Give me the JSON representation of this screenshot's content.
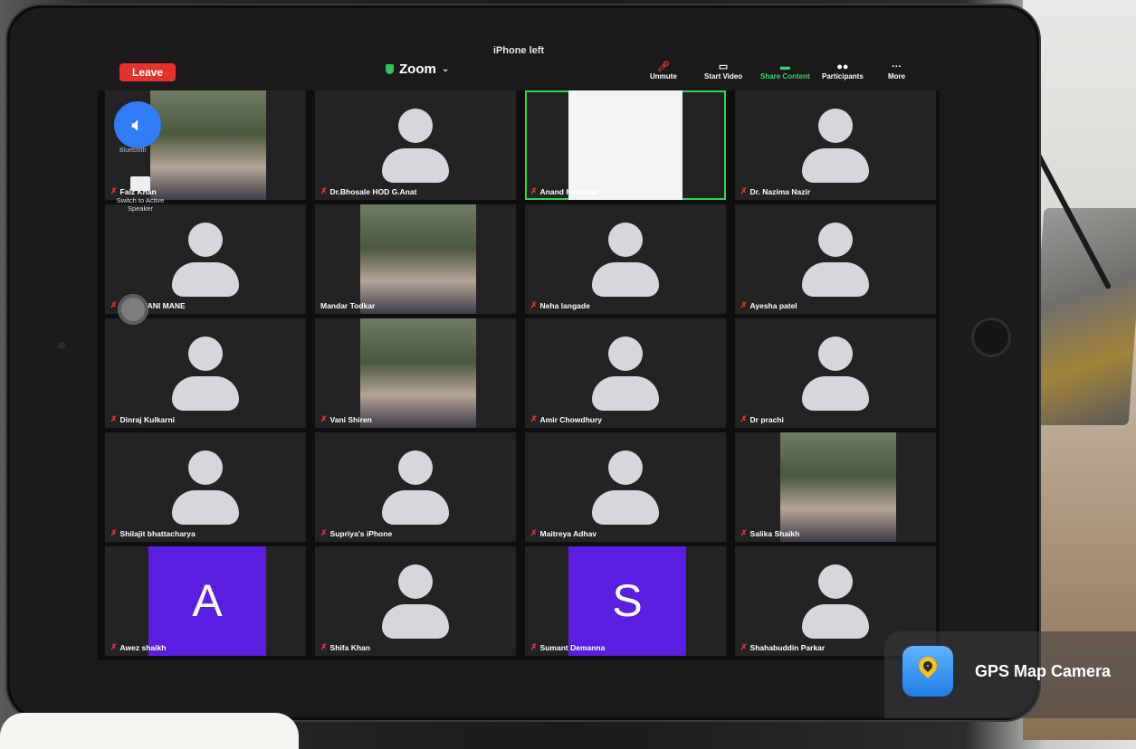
{
  "device_name": "iPhone left",
  "toolbar": {
    "leave": "Leave",
    "app_title": "Zoom",
    "buttons": [
      {
        "label": "Unmute"
      },
      {
        "label": "Start Video"
      },
      {
        "label": "Share Content"
      },
      {
        "label": "Participants"
      },
      {
        "label": "More"
      }
    ]
  },
  "controls": {
    "bluetooth_label": "Bluetooth",
    "switch_speaker": "Switch to Active Speaker"
  },
  "participants": [
    {
      "name": "Faiz Khan",
      "muted": true,
      "kind": "photo"
    },
    {
      "name": "Dr.Bhosale HOD G.Anat",
      "muted": true,
      "kind": "avatar"
    },
    {
      "name": "Anand Kalaskar",
      "muted": true,
      "kind": "video-white",
      "active": true
    },
    {
      "name": "Dr. Nazima Nazir",
      "muted": true,
      "kind": "avatar"
    },
    {
      "name": "SANJIVANI MANE",
      "muted": true,
      "kind": "avatar"
    },
    {
      "name": "Mandar Todkar",
      "muted": false,
      "kind": "photo"
    },
    {
      "name": "Neha langade",
      "muted": true,
      "kind": "avatar"
    },
    {
      "name": "Ayesha patel",
      "muted": true,
      "kind": "avatar"
    },
    {
      "name": "Dinraj Kulkarni",
      "muted": true,
      "kind": "avatar"
    },
    {
      "name": "Vani Shiren",
      "muted": true,
      "kind": "photo"
    },
    {
      "name": "Amir Chowdhury",
      "muted": true,
      "kind": "avatar"
    },
    {
      "name": "Dr prachi",
      "muted": true,
      "kind": "avatar"
    },
    {
      "name": "Shilajit bhattacharya",
      "muted": true,
      "kind": "avatar"
    },
    {
      "name": "Supriya's iPhone",
      "muted": true,
      "kind": "avatar"
    },
    {
      "name": "Maitreya Adhav",
      "muted": true,
      "kind": "avatar"
    },
    {
      "name": "Salika Shaikh",
      "muted": true,
      "kind": "photo"
    },
    {
      "name": "Awez shaikh",
      "muted": true,
      "kind": "initial",
      "initial": "A"
    },
    {
      "name": "Shifa Khan",
      "muted": true,
      "kind": "avatar"
    },
    {
      "name": "Sumant Demanna",
      "muted": true,
      "kind": "initial",
      "initial": "S"
    },
    {
      "name": "Shahabuddin Parkar",
      "muted": true,
      "kind": "avatar"
    }
  ],
  "watermark": {
    "text": "GPS Map Camera",
    "icon": "gps-map-camera-icon"
  },
  "colors": {
    "leave": "#e5322d",
    "active_border": "#35d34f",
    "initial_bg": "#5b1ee0",
    "share_green": "#3bd16f"
  }
}
